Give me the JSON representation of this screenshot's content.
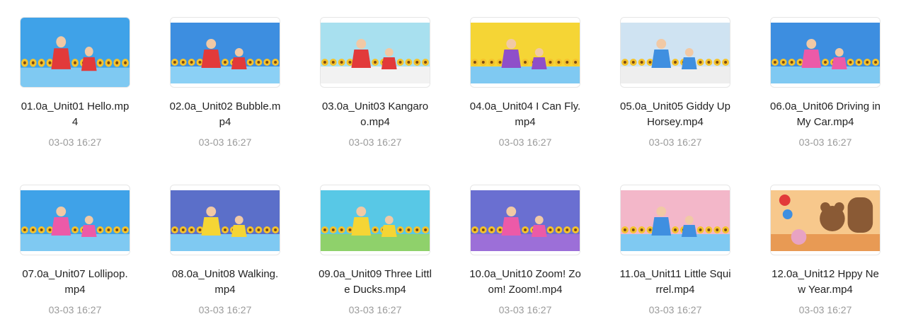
{
  "files": [
    {
      "name": "01.0a_Unit01 Hello.mp4",
      "time": "03-03 16:27",
      "icon": "video-thumbnail",
      "colors": {
        "bg": "#3fa2e8",
        "floor": "#7fc9f2",
        "adult": "#e23a3a",
        "kid": "#e23a3a"
      }
    },
    {
      "name": "02.0a_Unit02 Bubble.mp4",
      "time": "03-03 16:27",
      "icon": "video-thumbnail",
      "colors": {
        "bg": "#3d8ee0",
        "floor": "#8bd0f5",
        "adult": "#e23a3a",
        "kid": "#e23a3a"
      }
    },
    {
      "name": "03.0a_Unit03 Kangaroo.mp4",
      "time": "03-03 16:27",
      "icon": "video-thumbnail",
      "colors": {
        "bg": "#a8e0ef",
        "floor": "#f2f2f2",
        "adult": "#e23a3a",
        "kid": "#e23a3a"
      }
    },
    {
      "name": "04.0a_Unit04 I Can Fly.mp4",
      "time": "03-03 16:27",
      "icon": "video-thumbnail",
      "colors": {
        "bg": "#f5d535",
        "floor": "#7fc9f2",
        "adult": "#8f4fc9",
        "kid": "#8f4fc9"
      }
    },
    {
      "name": "05.0a_Unit05 Giddy Up Horsey.mp4",
      "time": "03-03 16:27",
      "icon": "video-thumbnail",
      "colors": {
        "bg": "#cfe3f2",
        "floor": "#eeeeee",
        "adult": "#3f8fe0",
        "kid": "#3f8fe0"
      }
    },
    {
      "name": "06.0a_Unit06 Driving in My Car.mp4",
      "time": "03-03 16:27",
      "icon": "video-thumbnail",
      "colors": {
        "bg": "#3d8ee0",
        "floor": "#7fc9f2",
        "adult": "#ec5aa8",
        "kid": "#ec5aa8"
      }
    },
    {
      "name": "07.0a_Unit07 Lollipop.mp4",
      "time": "03-03 16:27",
      "icon": "video-thumbnail",
      "colors": {
        "bg": "#3fa2e8",
        "floor": "#7fc9f2",
        "adult": "#ec5aa8",
        "kid": "#ec5aa8"
      }
    },
    {
      "name": "08.0a_Unit08 Walking.mp4",
      "time": "03-03 16:27",
      "icon": "video-thumbnail",
      "colors": {
        "bg": "#5b6fc9",
        "floor": "#7fc9f2",
        "adult": "#f5d535",
        "kid": "#f5d535"
      }
    },
    {
      "name": "09.0a_Unit09 Three Little Ducks.mp4",
      "time": "03-03 16:27",
      "icon": "video-thumbnail",
      "colors": {
        "bg": "#58c8e6",
        "floor": "#8fd16b",
        "adult": "#f5d535",
        "kid": "#f5d535"
      }
    },
    {
      "name": "10.0a_Unit10 Zoom! Zoom! Zoom!.mp4",
      "time": "03-03 16:27",
      "icon": "video-thumbnail",
      "colors": {
        "bg": "#6a6fd1",
        "floor": "#9c6fd8",
        "adult": "#ec5aa8",
        "kid": "#ec5aa8"
      }
    },
    {
      "name": "11.0a_Unit11 Little Squirrel.mp4",
      "time": "03-03 16:27",
      "icon": "video-thumbnail",
      "colors": {
        "bg": "#f3b7c9",
        "floor": "#7fc9f2",
        "adult": "#3f8fe0",
        "kid": "#3f8fe0"
      }
    },
    {
      "name": "12.0a_Unit12 Hppy New Year.mp4",
      "time": "03-03 16:27",
      "icon": "video-thumbnail",
      "colors": {
        "bg": "#f7c88c",
        "floor": "#e89a54",
        "adult": "#8a5a35",
        "kid": "#e8a3c3"
      }
    }
  ]
}
